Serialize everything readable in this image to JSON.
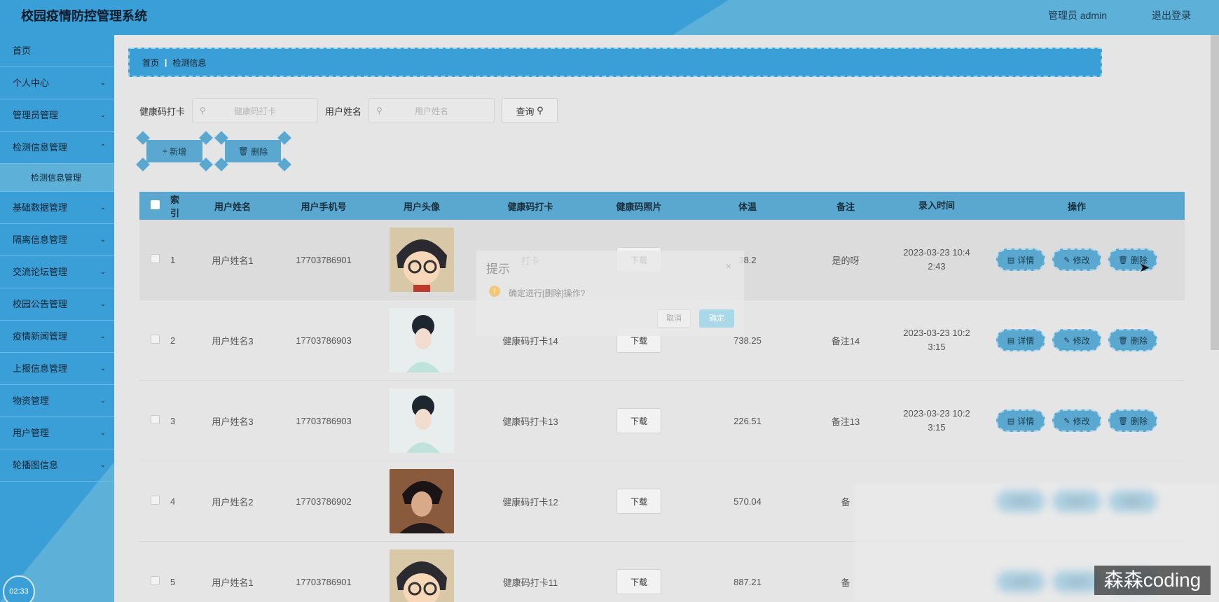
{
  "header": {
    "app_title": "校园疫情防控管理系统",
    "user_label": "管理员 admin",
    "logout_label": "退出登录"
  },
  "sidebar": {
    "items": [
      {
        "label": "首页",
        "has_children": false
      },
      {
        "label": "个人中心",
        "has_children": true
      },
      {
        "label": "管理员管理",
        "has_children": true
      },
      {
        "label": "检测信息管理",
        "has_children": true,
        "expanded": true
      },
      {
        "label": "基础数据管理",
        "has_children": true
      },
      {
        "label": "隔离信息管理",
        "has_children": true
      },
      {
        "label": "交流论坛管理",
        "has_children": true
      },
      {
        "label": "校园公告管理",
        "has_children": true
      },
      {
        "label": "疫情新闻管理",
        "has_children": true
      },
      {
        "label": "上报信息管理",
        "has_children": true
      },
      {
        "label": "物资管理",
        "has_children": true
      },
      {
        "label": "用户管理",
        "has_children": true
      },
      {
        "label": "轮播图信息",
        "has_children": true
      }
    ],
    "sub_item": "检测信息管理",
    "clock": "02:33"
  },
  "breadcrumb": {
    "home": "首页",
    "current": "检测信息"
  },
  "search": {
    "field1_label": "健康码打卡",
    "field1_placeholder": "健康码打卡",
    "field2_label": "用户姓名",
    "field2_placeholder": "用户姓名",
    "query_button": "查询"
  },
  "actions": {
    "add_button": "新增",
    "delete_button": "删除"
  },
  "table": {
    "columns": [
      "索引",
      "用户姓名",
      "用户手机号",
      "用户头像",
      "健康码打卡",
      "健康码照片",
      "体温",
      "备注",
      "录入时间",
      "操作"
    ],
    "rows": [
      {
        "index": "1",
        "name": "用户姓名1",
        "phone": "17703786901",
        "avatar": "cartoon",
        "punch": "打卡",
        "photo_button": "下载",
        "temp": "38.2",
        "note": "是的呀",
        "time_line1": "2023-03-23 10:4",
        "time_line2": "2:43"
      },
      {
        "index": "2",
        "name": "用户姓名3",
        "phone": "17703786903",
        "avatar": "woman",
        "punch": "健康码打卡14",
        "photo_button": "下载",
        "temp": "738.25",
        "note": "备注14",
        "time_line1": "2023-03-23 10:2",
        "time_line2": "3:15"
      },
      {
        "index": "3",
        "name": "用户姓名3",
        "phone": "17703786903",
        "avatar": "woman",
        "punch": "健康码打卡13",
        "photo_button": "下载",
        "temp": "226.51",
        "note": "备注13",
        "time_line1": "2023-03-23 10:2",
        "time_line2": "3:15"
      },
      {
        "index": "4",
        "name": "用户姓名2",
        "phone": "17703786902",
        "avatar": "man",
        "punch": "健康码打卡12",
        "photo_button": "下载",
        "temp": "570.04",
        "note": "备",
        "time_line1": "",
        "time_line2": ""
      },
      {
        "index": "5",
        "name": "用户姓名1",
        "phone": "17703786901",
        "avatar": "cartoon",
        "punch": "健康码打卡11",
        "photo_button": "下载",
        "temp": "887.21",
        "note": "备",
        "time_line1": "",
        "time_line2": ""
      }
    ],
    "op_labels": {
      "detail": "详情",
      "edit": "修改",
      "delete": "删除"
    }
  },
  "dialog": {
    "title": "提示",
    "message": "确定进行[删除]操作?",
    "cancel": "取消",
    "confirm": "确定"
  },
  "watermark": "森森coding",
  "colors": {
    "primary": "#3a9fd6",
    "accent_light": "#5db0d8",
    "button": "#5aa8d0"
  }
}
